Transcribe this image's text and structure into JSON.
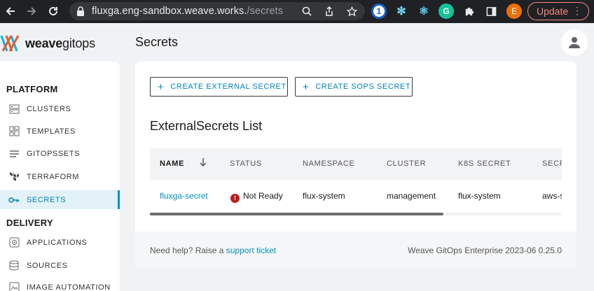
{
  "browser": {
    "url_host": "fluxga.eng-sandbox.weave.works.",
    "url_path": "/secrets",
    "profile_initial": "E",
    "update_label": "Update"
  },
  "header": {
    "logo_bold": "weave",
    "logo_light": "gitops",
    "page_title": "Secrets"
  },
  "sidebar": {
    "platform_title": "PLATFORM",
    "delivery_title": "DELIVERY",
    "items": [
      {
        "label": "CLUSTERS",
        "icon": "clusters-icon"
      },
      {
        "label": "TEMPLATES",
        "icon": "templates-icon"
      },
      {
        "label": "GITOPSSETS",
        "icon": "gitopssets-icon"
      },
      {
        "label": "TERRAFORM",
        "icon": "terraform-icon"
      },
      {
        "label": "SECRETS",
        "icon": "key-icon"
      },
      {
        "label": "APPLICATIONS",
        "icon": "applications-icon"
      },
      {
        "label": "SOURCES",
        "icon": "sources-icon"
      },
      {
        "label": "IMAGE AUTOMATION",
        "icon": "image-automation-icon"
      }
    ]
  },
  "main": {
    "create_external_label": "CREATE EXTERNAL SECRET",
    "create_sops_label": "CREATE SOPS SECRET",
    "list_title": "ExternalSecrets List",
    "columns": [
      "NAME",
      "STATUS",
      "NAMESPACE",
      "CLUSTER",
      "K8S SECRET",
      "SECR"
    ],
    "rows": [
      {
        "name": "fluxga-secret",
        "status": "Not Ready",
        "namespace": "flux-system",
        "cluster": "management",
        "k8s_secret": "flux-system",
        "secret_store": "aws-s"
      }
    ],
    "footer_help_prefix": "Need help? Raise a",
    "footer_help_link": "support ticket",
    "footer_version": "Weave GitOps Enterprise 2023-06 0.25.0"
  },
  "colors": {
    "accent": "#0093c4",
    "error": "#b71c1c",
    "update_red": "#f28b82"
  }
}
